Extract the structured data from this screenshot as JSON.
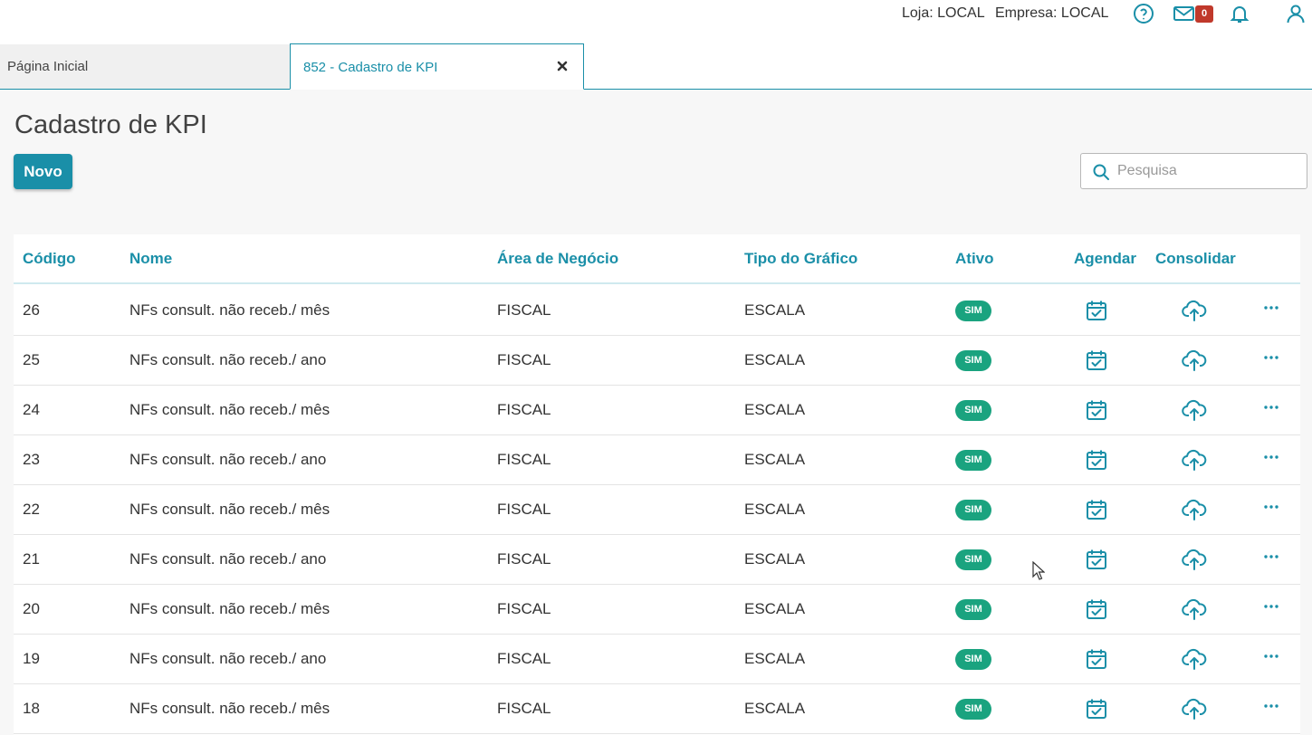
{
  "topbar": {
    "loja": "Loja: LOCAL",
    "empresa": "Empresa: LOCAL",
    "mail_badge": "0",
    "icons": [
      "help-icon",
      "mail-icon",
      "bell-icon",
      "user-icon"
    ]
  },
  "tabs": {
    "home_label": "Página Inicial",
    "active_label": "852 - Cadastro de KPI"
  },
  "page": {
    "title": "Cadastro de KPI",
    "new_button": "Novo",
    "search_placeholder": "Pesquisa"
  },
  "table": {
    "headers": {
      "codigo": "Código",
      "nome": "Nome",
      "area": "Área de Negócio",
      "tipo": "Tipo do Gráfico",
      "ativo": "Ativo",
      "agendar": "Agendar",
      "consolidar": "Consolidar"
    },
    "rows": [
      {
        "codigo": "26",
        "nome": "NFs consult. não receb./ mês",
        "area": "FISCAL",
        "tipo": "ESCALA",
        "ativo": "SIM"
      },
      {
        "codigo": "25",
        "nome": "NFs consult. não receb./ ano",
        "area": "FISCAL",
        "tipo": "ESCALA",
        "ativo": "SIM"
      },
      {
        "codigo": "24",
        "nome": "NFs consult. não receb./ mês",
        "area": "FISCAL",
        "tipo": "ESCALA",
        "ativo": "SIM"
      },
      {
        "codigo": "23",
        "nome": "NFs consult. não receb./ ano",
        "area": "FISCAL",
        "tipo": "ESCALA",
        "ativo": "SIM"
      },
      {
        "codigo": "22",
        "nome": "NFs consult. não receb./ mês",
        "area": "FISCAL",
        "tipo": "ESCALA",
        "ativo": "SIM"
      },
      {
        "codigo": "21",
        "nome": "NFs consult. não receb./ ano",
        "area": "FISCAL",
        "tipo": "ESCALA",
        "ativo": "SIM"
      },
      {
        "codigo": "20",
        "nome": "NFs consult. não receb./ mês",
        "area": "FISCAL",
        "tipo": "ESCALA",
        "ativo": "SIM"
      },
      {
        "codigo": "19",
        "nome": "NFs consult. não receb./ ano",
        "area": "FISCAL",
        "tipo": "ESCALA",
        "ativo": "SIM"
      },
      {
        "codigo": "18",
        "nome": "NFs consult. não receb./ mês",
        "area": "FISCAL",
        "tipo": "ESCALA",
        "ativo": "SIM"
      }
    ]
  },
  "colors": {
    "accent": "#1a8fa8",
    "active_pill": "#1aa37f",
    "badge": "#c0392b"
  }
}
